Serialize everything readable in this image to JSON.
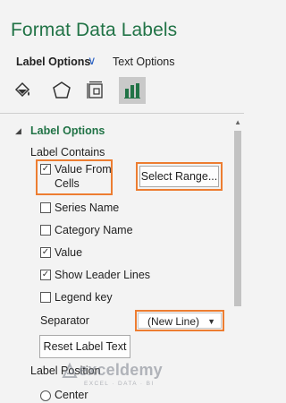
{
  "pane": {
    "title": "Format Data Labels"
  },
  "tabs": {
    "active": "Label Options",
    "other": "Text Options",
    "active_icon": "chevron-down-icon"
  },
  "icon_bar": [
    {
      "name": "fill-line-icon",
      "selected": false
    },
    {
      "name": "effects-icon",
      "selected": false
    },
    {
      "name": "size-properties-icon",
      "selected": false
    },
    {
      "name": "label-options-chart-icon",
      "selected": true
    }
  ],
  "label_options": {
    "section_title": "Label Options",
    "label_contains": "Label Contains",
    "value_from_cells": {
      "line1": "Value From",
      "line2": "Cells",
      "checked": true
    },
    "select_range_button": "Select Range...",
    "series_name": {
      "label": "Series Name",
      "checked": false
    },
    "category_name": {
      "label": "Category Name",
      "checked": false
    },
    "value": {
      "label": "Value",
      "checked": true
    },
    "show_leader_lines": {
      "label": "Show Leader Lines",
      "checked": true
    },
    "legend_key": {
      "label": "Legend key",
      "checked": false
    },
    "separator_label": "Separator",
    "separator_value": "(New Line)",
    "reset_button": "Reset Label Text",
    "label_position": "Label Position",
    "center": {
      "label": "Center",
      "selected": false
    }
  },
  "watermark": {
    "name": "exceldemy",
    "tagline": "EXCEL · DATA · BI"
  },
  "colors": {
    "accent_green": "#217346",
    "highlight_orange": "#ed7d31",
    "tab_chevron": "#2b62c4"
  }
}
